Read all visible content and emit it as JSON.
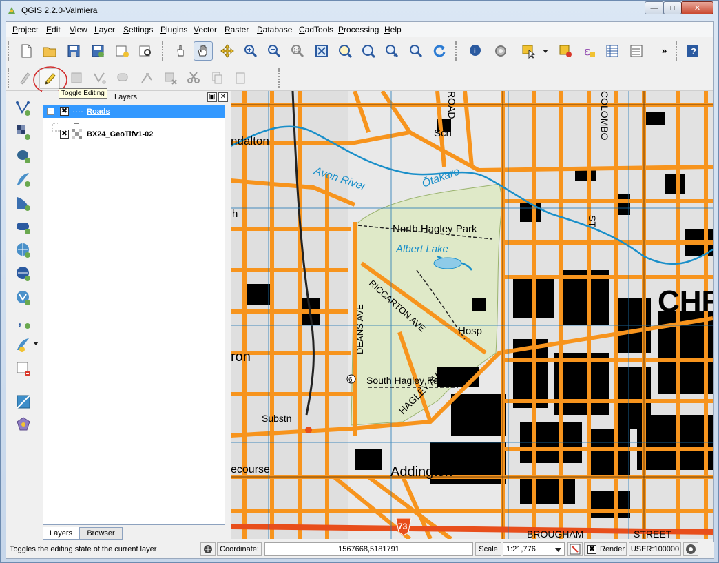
{
  "window": {
    "title": "QGIS 2.2.0-Valmiera",
    "min_label": "—",
    "max_label": "□",
    "close_label": "✕"
  },
  "menu": [
    "Project",
    "Edit",
    "View",
    "Layer",
    "Settings",
    "Plugins",
    "Vector",
    "Raster",
    "Database",
    "CadTools",
    "Processing",
    "Help"
  ],
  "toolbar": {
    "overflow_label": "»",
    "file_icons": [
      "new-project-icon",
      "open-project-icon",
      "save-project-icon",
      "save-as-icon",
      "new-print-composer-icon",
      "composer-manager-icon"
    ],
    "nav_icons": [
      "touch-zoom-icon",
      "pan-map-icon",
      "pan-to-selection-icon",
      "zoom-in-icon",
      "zoom-out-icon",
      "zoom-native-icon",
      "zoom-full-icon",
      "zoom-to-selection-icon",
      "zoom-to-layer-icon",
      "zoom-last-icon",
      "zoom-next-icon",
      "refresh-icon"
    ],
    "tool_icons": [
      "identify-icon",
      "settings-action-icon",
      "select-features-icon",
      "deselect-icon",
      "expression-icon",
      "attribute-table-icon",
      "statistics-icon"
    ],
    "help_icon": "help-icon"
  },
  "digitizing_toolbar": {
    "icons": [
      "current-edits-icon",
      "toggle-editing-icon",
      "save-edits-icon",
      "add-feature-icon",
      "move-feature-icon",
      "node-tool-icon",
      "delete-selected-icon",
      "cut-features-icon",
      "copy-features-icon",
      "paste-features-icon"
    ],
    "tooltip": "Toggle Editing"
  },
  "left_toolbar": {
    "icons": [
      "add-vector-layer-icon",
      "add-raster-layer-icon",
      "add-postgis-layer-icon",
      "add-spatialite-layer-icon",
      "add-mssql-layer-icon",
      "add-oracle-layer-icon",
      "add-wms-layer-icon",
      "add-wcs-layer-icon",
      "add-wfs-layer-icon",
      "add-delimited-text-icon",
      "new-shapefile-icon",
      "remove-layer-icon",
      "georeferencer-icon",
      "gps-icon"
    ]
  },
  "layers_panel": {
    "title": "Layers",
    "layers": [
      {
        "name": "Roads",
        "checked": "✖",
        "selected": true
      },
      {
        "name": "BX24_GeoTifv1-02",
        "checked": "✖",
        "selected": false
      }
    ],
    "tabs": [
      "Layers",
      "Browser"
    ],
    "restore_label": "▣",
    "close_label": "✕"
  },
  "map": {
    "labels": {
      "ndalton": "ndalton",
      "avon_river": "Avon River",
      "otakaro": "Ōtakaro",
      "north_hagley": "North Hagley Park",
      "albert_lake": "Albert Lake",
      "riccarton_ave": "RICCARTON AVE",
      "hosp": "Hosp",
      "deans_ave": "DEANS AVE",
      "south_hagley": "South Hagley Park",
      "hagley_ave": "HAGLEY AVE",
      "ron": "ron",
      "substn": "Substn",
      "ecourse": "ecourse",
      "addington": "Addington",
      "chr": "CHR",
      "colombo": "COLOMBO",
      "sch": "Sch",
      "st": "ST",
      "brougham": "BROUGHAM",
      "street": "STREET",
      "road": "ROAD",
      "route_73": "73",
      "six": "6",
      "h_label": "h"
    },
    "road_color": "#f7941d",
    "water_color": "#1a8fc9",
    "park_color": "#d8e6c0"
  },
  "status": {
    "message": "Toggles the editing state of the current layer",
    "coordinate_label": "Coordinate:",
    "coordinate_value": "1567668,5181791",
    "scale_label": "Scale",
    "scale_value": "1:21,776",
    "render_label": "Render",
    "render_checked": "✖",
    "crs_label": "USER:100000"
  }
}
